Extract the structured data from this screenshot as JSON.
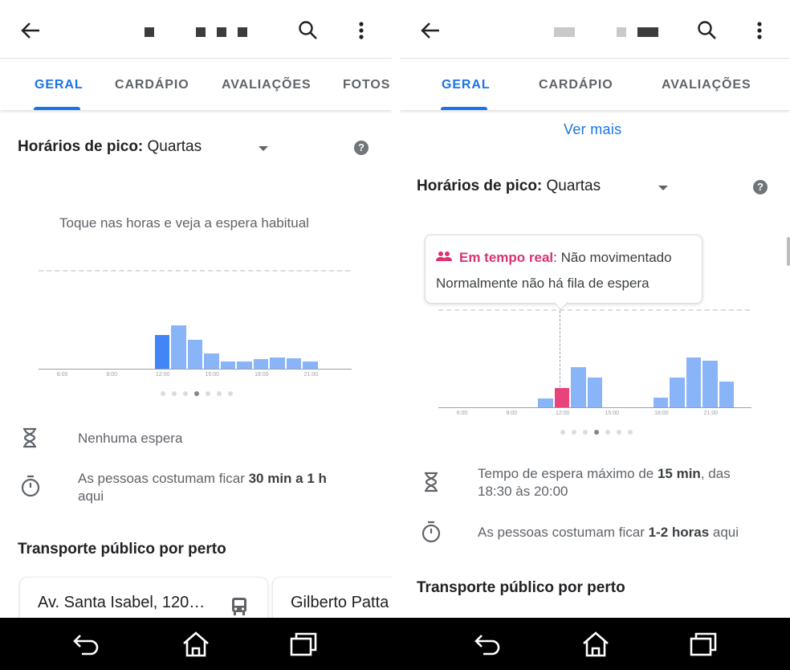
{
  "left": {
    "tabs": [
      {
        "label": "GERAL",
        "active": true
      },
      {
        "label": "CARDÁPIO",
        "active": false
      },
      {
        "label": "AVALIAÇÕES",
        "active": false
      },
      {
        "label": "FOTOS",
        "active": false
      }
    ],
    "peak": {
      "label": "Horários de pico:",
      "day": "Quartas"
    },
    "hint": "Toque nas horas e veja a espera habitual",
    "info": {
      "wait": "Nenhuma espera",
      "stay_prefix": "As pessoas costumam ficar ",
      "stay_bold": "30 min a 1 h",
      "stay_suffix": "aqui"
    },
    "transport_heading": "Transporte público por perto",
    "cards": [
      "Av. Santa Isabel, 120…",
      "Gilberto Patta"
    ]
  },
  "right": {
    "tabs": [
      {
        "label": "GERAL",
        "active": true
      },
      {
        "label": "CARDÁPIO",
        "active": false
      },
      {
        "label": "AVALIAÇÕES",
        "active": false
      }
    ],
    "see_more": "Ver mais",
    "peak": {
      "label": "Horários de pico:",
      "day": "Quartas"
    },
    "tooltip": {
      "live_label": "Em tempo real",
      "live_status": ": Não movimentado",
      "line2": "Normalmente não há fila de espera"
    },
    "info": {
      "wait_prefix": "Tempo de espera máximo de ",
      "wait_bold": "15 min",
      "wait_suffix": ", das",
      "wait_line2": "18:30 às 20:00",
      "stay_prefix": "As pessoas costumam ficar ",
      "stay_bold": "1-2 horas",
      "stay_suffix": " aqui"
    },
    "transport_heading": "Transporte público por perto"
  },
  "chart_data": [
    {
      "type": "bar",
      "title": "",
      "x_tick_labels": [
        "6:00",
        "9:00",
        "12:00",
        "15:00",
        "18:00",
        "21:00"
      ],
      "x": [
        "12:00",
        "13:00",
        "14:00",
        "15:00",
        "16:00",
        "17:00",
        "18:00",
        "19:00",
        "20:00",
        "21:00"
      ],
      "values": [
        36,
        46,
        31,
        16,
        8,
        8,
        10,
        12,
        11,
        8
      ],
      "highlight_index": 0,
      "page_dots": 7,
      "active_dot": 3
    },
    {
      "type": "bar",
      "title": "",
      "x_tick_labels": [
        "6:00",
        "9:00",
        "12:00",
        "15:00",
        "18:00",
        "21:00"
      ],
      "x": [
        "11:00",
        "12:00",
        "13:00",
        "14:00",
        "15:00",
        "16:00",
        "17:00",
        "18:00",
        "19:00",
        "20:00",
        "21:00",
        "22:00"
      ],
      "values": [
        9,
        20,
        42,
        31,
        0,
        0,
        0,
        10,
        31,
        52,
        48,
        27
      ],
      "live_index": 1,
      "live_color": "#e8437a",
      "page_dots": 7,
      "active_dot": 3
    }
  ],
  "colors": {
    "accent": "#1a73e8",
    "bar": "#8ab4f8",
    "bar_highlight": "#4285f4",
    "live": "#d93275"
  }
}
